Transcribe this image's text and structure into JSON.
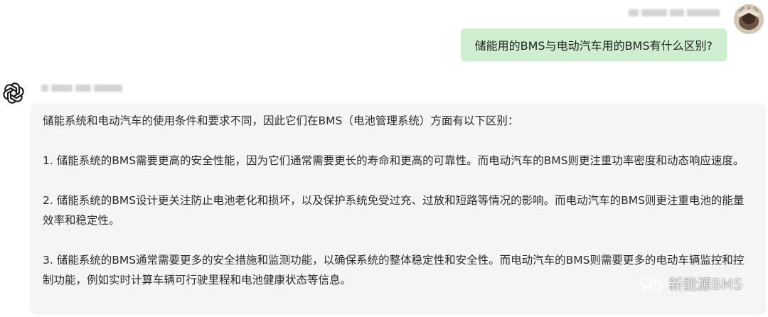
{
  "user": {
    "avatar_icon": "user-photo-avatar-icon",
    "message": "储能用的BMS与电动汽车用的BMS有什么区别?"
  },
  "assistant": {
    "avatar_icon": "openai-logo-icon",
    "paragraphs": [
      "储能系统和电动汽车的使用条件和要求不同，因此它们在BMS（电池管理系统）方面有以下区别：",
      "1. 储能系统的BMS需要更高的安全性能，因为它们通常需要更长的寿命和更高的可靠性。而电动汽车的BMS则更注重功率密度和动态响应速度。",
      "2. 储能系统的BMS设计更关注防止电池老化和损坏，以及保护系统免受过充、过放和短路等情况的影响。而电动汽车的BMS则更注重电池的能量效率和稳定性。",
      "3. 储能系统的BMS通常需要更多的安全措施和监测功能，以确保系统的整体稳定性和安全性。而电动汽车的BMS则需要更多的电动车辆监控和控制功能，例如实时计算车辆可行驶里程和电池健康状态等信息。"
    ]
  },
  "watermark": {
    "icon": "wechat-icon",
    "text": "新能源BMS"
  },
  "colors": {
    "user_bubble": "#cfeecf",
    "assistant_bubble": "#f4f5f7"
  }
}
